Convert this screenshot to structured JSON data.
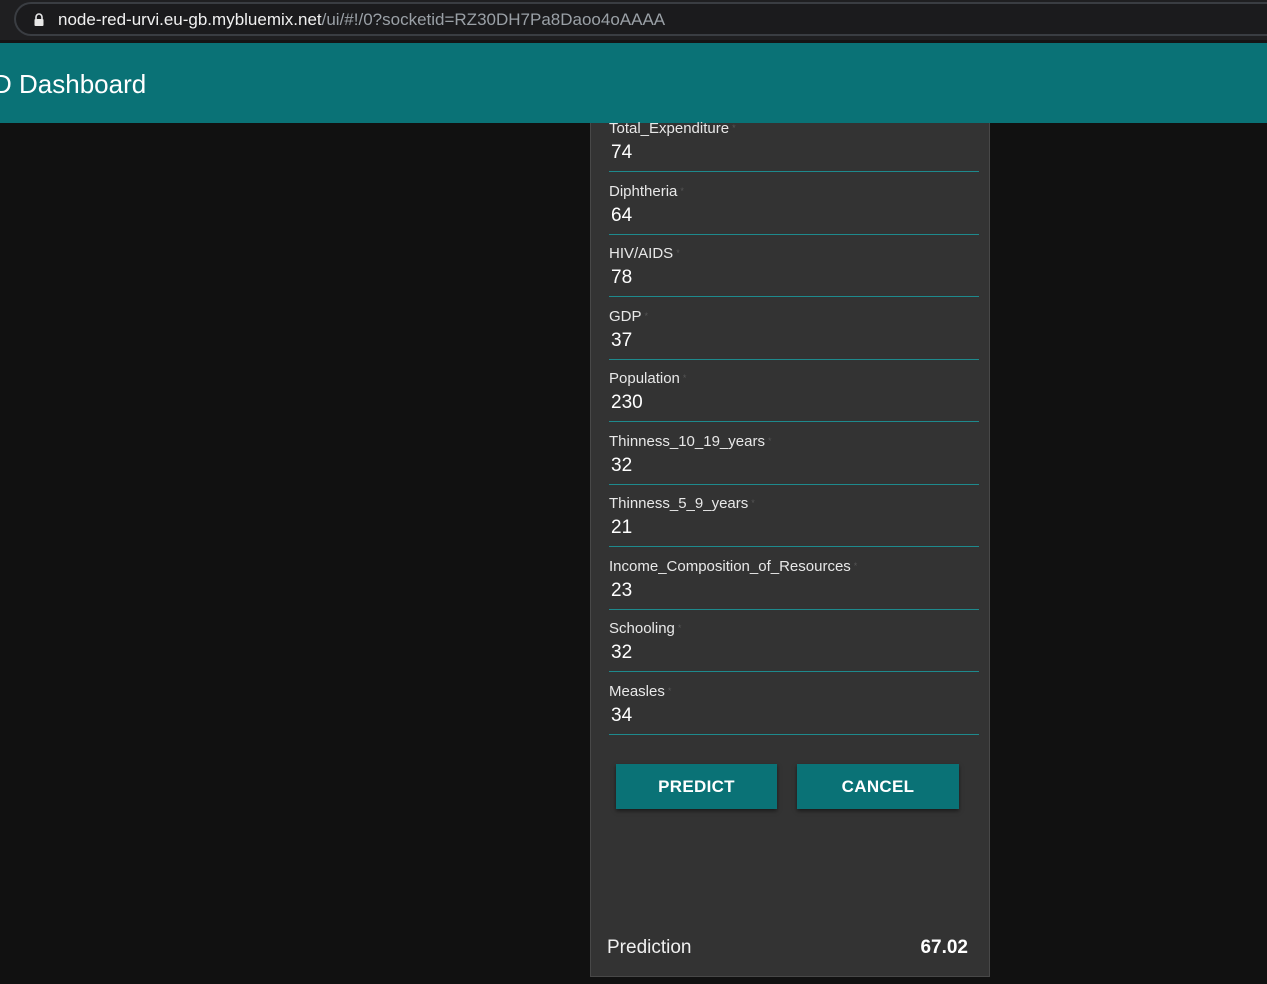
{
  "browser": {
    "url_host": "node-red-urvi.eu-gb.mybluemix.net",
    "url_path": "/ui/#!/0?socketid=RZ30DH7Pa8Daoo4oAAAA"
  },
  "toolbar": {
    "title": "D Dashboard",
    "color": "#0a7276"
  },
  "form": {
    "fields": [
      {
        "label": "Total_Expenditure",
        "value": "74"
      },
      {
        "label": "Diphtheria",
        "value": "64"
      },
      {
        "label": "HIV/AIDS",
        "value": "78"
      },
      {
        "label": "GDP",
        "value": "37"
      },
      {
        "label": "Population",
        "value": "230"
      },
      {
        "label": "Thinness_10_19_years",
        "value": "32"
      },
      {
        "label": "Thinness_5_9_years",
        "value": "21"
      },
      {
        "label": "Income_Composition_of_Resources",
        "value": "23"
      },
      {
        "label": "Schooling",
        "value": "32"
      },
      {
        "label": "Measles",
        "value": "34"
      }
    ],
    "predict_label": "PREDICT",
    "cancel_label": "CANCEL"
  },
  "result": {
    "label": "Prediction",
    "value": "67.02"
  }
}
